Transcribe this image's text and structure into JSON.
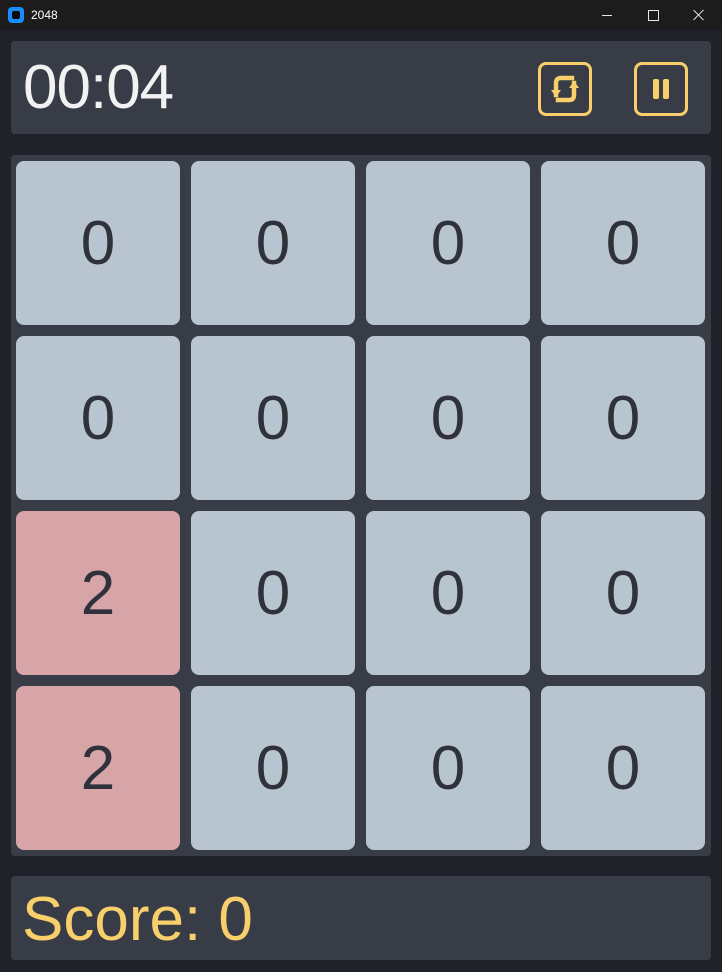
{
  "window": {
    "title": "2048"
  },
  "colors": {
    "accent": "#f8cf6a",
    "panel": "#383c47",
    "background": "#202229",
    "tile_empty": "#b8c4cf",
    "tile_2": "#d7a4a8",
    "tile_text": "#2f323b"
  },
  "header": {
    "timer": "00:04",
    "restart_icon": "restart-icon",
    "pause_icon": "pause-icon"
  },
  "board": {
    "rows": [
      [
        "0",
        "0",
        "0",
        "0"
      ],
      [
        "0",
        "0",
        "0",
        "0"
      ],
      [
        "2",
        "0",
        "0",
        "0"
      ],
      [
        "2",
        "0",
        "0",
        "0"
      ]
    ]
  },
  "score": {
    "text": "Score: 0"
  }
}
